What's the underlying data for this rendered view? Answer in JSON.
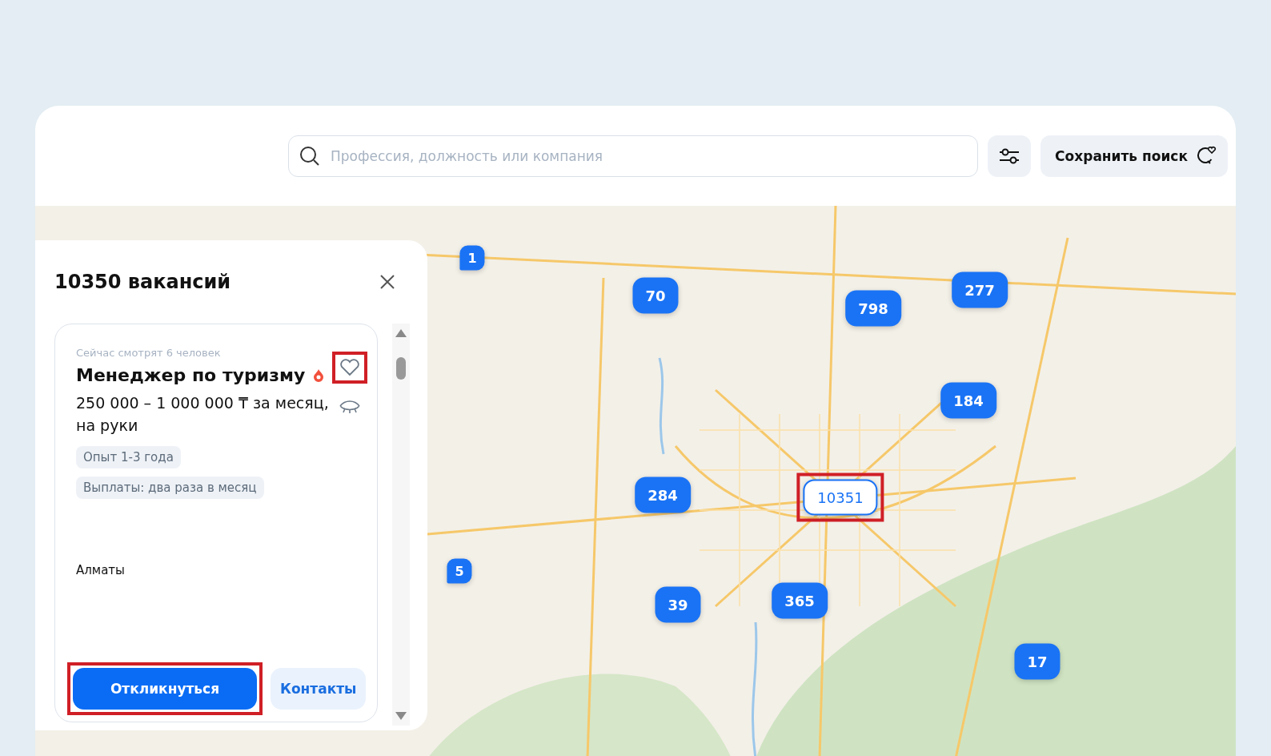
{
  "search": {
    "placeholder": "Профессия, должность или компания"
  },
  "save_search_button": {
    "label": "Сохранить поиск"
  },
  "panel": {
    "title": "10350 вакансий",
    "vacancy": {
      "viewers": "Сейчас смотрят 6 человек",
      "title": "Менеджер по туризму",
      "hot": true,
      "favorite_highlighted": true,
      "salary": "250 000 – 1 000 000 ₸ за месяц, на руки",
      "tags": [
        "Опыт 1-3 года",
        "Выплаты: два раза в месяц"
      ],
      "city": "Алматы",
      "apply_button": {
        "label": "Откликнуться",
        "highlighted": true
      },
      "contacts_button": {
        "label": "Контакты"
      }
    }
  },
  "map": {
    "markers": [
      {
        "kind": "pin",
        "label": "1",
        "selected": false,
        "highlighted": false
      },
      {
        "kind": "cluster",
        "label": "70",
        "selected": false,
        "highlighted": false
      },
      {
        "kind": "cluster",
        "label": "798",
        "selected": false,
        "highlighted": false
      },
      {
        "kind": "cluster",
        "label": "277",
        "selected": false,
        "highlighted": false
      },
      {
        "kind": "cluster",
        "label": "184",
        "selected": false,
        "highlighted": false
      },
      {
        "kind": "cluster",
        "label": "284",
        "selected": false,
        "highlighted": false
      },
      {
        "kind": "cluster",
        "label": "10351",
        "selected": true,
        "highlighted": true
      },
      {
        "kind": "pin",
        "label": "5",
        "selected": false,
        "highlighted": false
      },
      {
        "kind": "cluster",
        "label": "39",
        "selected": false,
        "highlighted": false
      },
      {
        "kind": "cluster",
        "label": "365",
        "selected": false,
        "highlighted": false
      },
      {
        "kind": "cluster",
        "label": "17",
        "selected": false,
        "highlighted": false
      }
    ]
  }
}
